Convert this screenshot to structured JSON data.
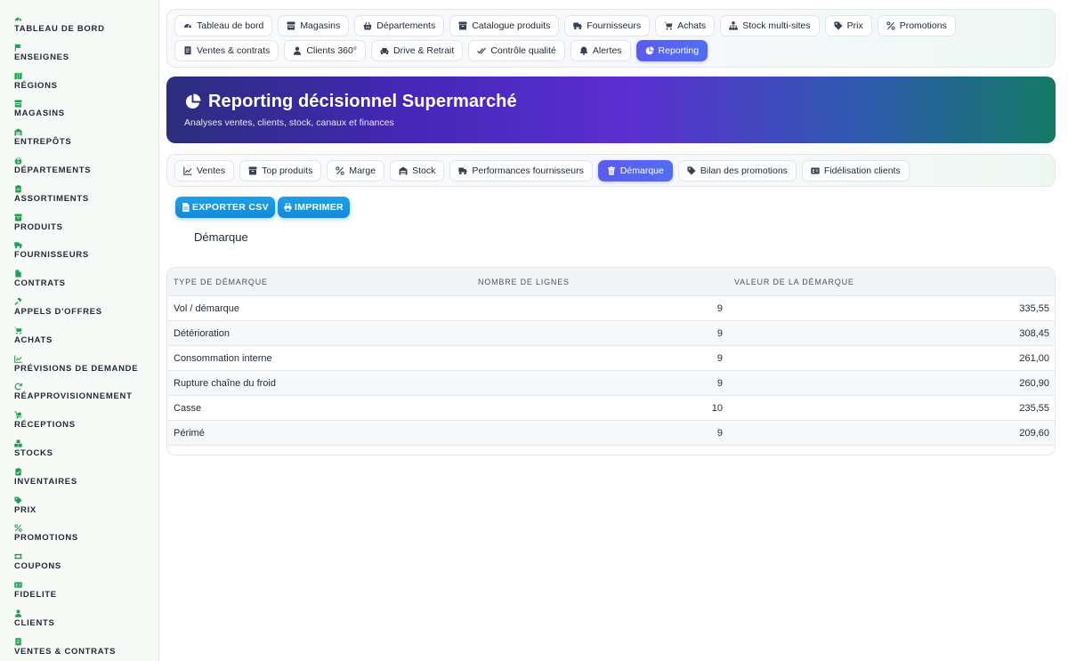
{
  "sidebar": {
    "items": [
      {
        "label": "TABLEAU DE BORD",
        "icon": "gauge-icon"
      },
      {
        "label": "ENSEIGNES",
        "icon": "flag-icon"
      },
      {
        "label": "RÉGIONS",
        "icon": "map-icon"
      },
      {
        "label": "MAGASINS",
        "icon": "store-icon"
      },
      {
        "label": "ENTREPÔTS",
        "icon": "warehouse-icon"
      },
      {
        "label": "DÉPARTEMENTS",
        "icon": "basket-icon"
      },
      {
        "label": "ASSORTIMENTS",
        "icon": "clipboard-icon"
      },
      {
        "label": "PRODUITS",
        "icon": "box-icon"
      },
      {
        "label": "FOURNISSEURS",
        "icon": "truck-icon"
      },
      {
        "label": "CONTRATS",
        "icon": "file-icon"
      },
      {
        "label": "APPELS D'OFFRES",
        "icon": "gavel-icon"
      },
      {
        "label": "ACHATS",
        "icon": "cart-icon"
      },
      {
        "label": "PRÉVISIONS DE DEMANDE",
        "icon": "chart-line-icon"
      },
      {
        "label": "RÉAPPROVISIONNEMENT",
        "icon": "refresh-icon"
      },
      {
        "label": "RÉCEPTIONS",
        "icon": "dolly-icon"
      },
      {
        "label": "STOCKS",
        "icon": "boxes-icon"
      },
      {
        "label": "INVENTAIRES",
        "icon": "clipboard-check-icon"
      },
      {
        "label": "PRIX",
        "icon": "tags-icon"
      },
      {
        "label": "PROMOTIONS",
        "icon": "percent-icon"
      },
      {
        "label": "COUPONS",
        "icon": "ticket-icon"
      },
      {
        "label": "FIDELITE",
        "icon": "id-card-icon"
      },
      {
        "label": "CLIENTS",
        "icon": "user-icon"
      },
      {
        "label": "VENTES & CONTRATS",
        "icon": "receipt-icon"
      }
    ]
  },
  "topnav": {
    "tabs": [
      {
        "label": "Tableau de bord",
        "icon": "gauge-icon"
      },
      {
        "label": "Magasins",
        "icon": "store-icon"
      },
      {
        "label": "Départements",
        "icon": "basket-icon"
      },
      {
        "label": "Catalogue produits",
        "icon": "box-icon"
      },
      {
        "label": "Fournisseurs",
        "icon": "truck-icon"
      },
      {
        "label": "Achats",
        "icon": "cart-icon"
      },
      {
        "label": "Stock multi-sites",
        "icon": "network-icon"
      },
      {
        "label": "Prix",
        "icon": "tags-icon"
      },
      {
        "label": "Promotions",
        "icon": "percent-icon"
      },
      {
        "label": "Ventes & contrats",
        "icon": "receipt-icon"
      },
      {
        "label": "Clients 360°",
        "icon": "user-icon"
      },
      {
        "label": "Drive & Retrait",
        "icon": "car-icon"
      },
      {
        "label": "Contrôle qualité",
        "icon": "check-double-icon"
      },
      {
        "label": "Alertes",
        "icon": "bell-icon"
      },
      {
        "label": "Reporting",
        "icon": "pie-chart-icon"
      }
    ],
    "active": "Reporting"
  },
  "banner": {
    "title": "Reporting décisionnel Supermarché",
    "subtitle": "Analyses ventes, clients, stock, canaux et finances",
    "icon": "pie-chart-icon"
  },
  "subnav": {
    "tabs": [
      {
        "label": "Ventes",
        "icon": "chart-line-icon"
      },
      {
        "label": "Top produits",
        "icon": "box-icon"
      },
      {
        "label": "Marge",
        "icon": "percent-icon"
      },
      {
        "label": "Stock",
        "icon": "warehouse-icon"
      },
      {
        "label": "Performances fournisseurs",
        "icon": "truck-icon"
      },
      {
        "label": "Démarque",
        "icon": "trash-icon"
      },
      {
        "label": "Bilan des promotions",
        "icon": "tags-icon"
      },
      {
        "label": "Fidélisation clients",
        "icon": "id-card-icon"
      }
    ],
    "active": "Démarque"
  },
  "actions": {
    "export_label": "EXPORTER CSV",
    "print_label": "IMPRIMER"
  },
  "section": {
    "title": "Démarque"
  },
  "table": {
    "headers": [
      "TYPE DE DÉMARQUE",
      "NOMBRE DE LIGNES",
      "VALEUR DE LA DÉMARQUE"
    ],
    "rows": [
      {
        "type": "Vol / démarque",
        "count": "9",
        "value": "335,55"
      },
      {
        "type": "Détérioration",
        "count": "9",
        "value": "308,45"
      },
      {
        "type": "Consommation interne",
        "count": "9",
        "value": "261,00"
      },
      {
        "type": "Rupture chaîne du froid",
        "count": "9",
        "value": "260,90"
      },
      {
        "type": "Casse",
        "count": "10",
        "value": "235,55"
      },
      {
        "type": "Périmé",
        "count": "9",
        "value": "209,60"
      }
    ]
  },
  "colors": {
    "sidebar_icon": "#16a34a",
    "active_tab": "#5b5bf0",
    "action_button": "#1589d6"
  }
}
